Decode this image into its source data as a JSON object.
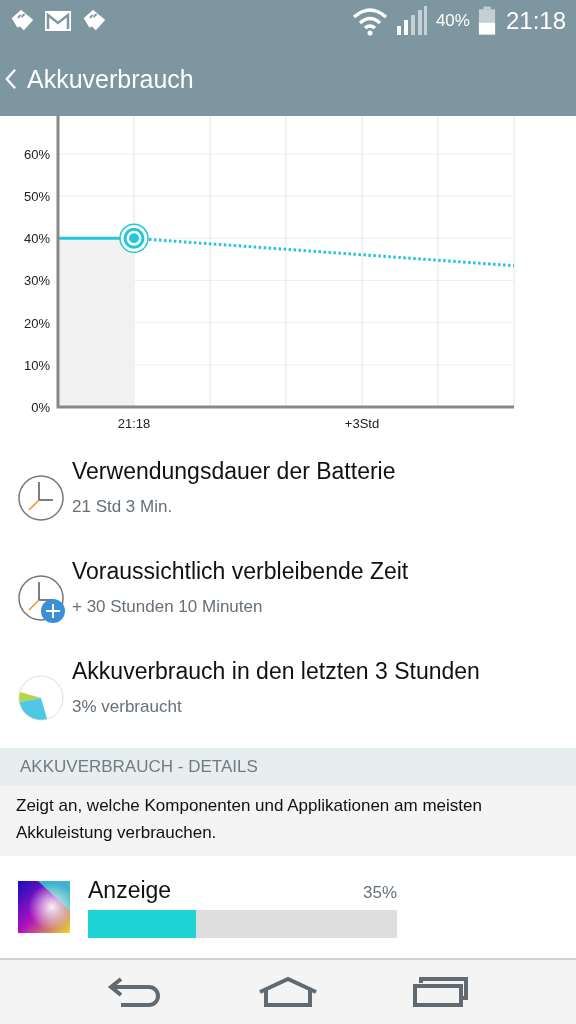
{
  "status_bar": {
    "battery_percent": "40%",
    "time": "21:18"
  },
  "app_bar": {
    "title": "Akkuverbrauch"
  },
  "chart_data": {
    "type": "line",
    "categories": [
      null,
      "21:18",
      null,
      null,
      "+3Std",
      null,
      null
    ],
    "ylim": [
      0,
      69
    ],
    "grid": true,
    "yticks": [
      {
        "value": 0,
        "label": "0%"
      },
      {
        "value": 10,
        "label": "10%"
      },
      {
        "value": 20,
        "label": "20%"
      },
      {
        "value": 30,
        "label": "30%"
      },
      {
        "value": 40,
        "label": "40%"
      },
      {
        "value": 50,
        "label": "50%"
      },
      {
        "value": 60,
        "label": "60%"
      }
    ],
    "series": [
      {
        "type": "area",
        "color": "#26c6da",
        "line_style": "solid",
        "values": [
          40,
          40,
          null,
          null,
          null,
          null,
          null
        ]
      },
      {
        "type": "line",
        "color": "#26c6da",
        "line_style": "dotted",
        "values": [
          null,
          40,
          38.7,
          37.4,
          36.1,
          34.8,
          33.5
        ]
      }
    ]
  },
  "info_items": [
    {
      "kind": "clock",
      "title": "Verwendungsdauer der Batterie",
      "value": "21 Std 3 Min."
    },
    {
      "kind": "clock-plus",
      "title": "Voraussichtlich verbleibende Zeit",
      "value": "+ 30 Stunden 10 Minuten"
    },
    {
      "kind": "pie",
      "title": "Akkuverbrauch in den letzten 3 Stunden",
      "value": "3% verbraucht"
    }
  ],
  "details": {
    "header": "AKKUVERBRAUCH - DETAILS",
    "description": "Zeigt an, welche Komponenten und Applikationen am meisten Akkuleistung verbrauchen.",
    "items": [
      {
        "name": "Anzeige",
        "percent": "35%",
        "level": 0.35
      }
    ]
  }
}
